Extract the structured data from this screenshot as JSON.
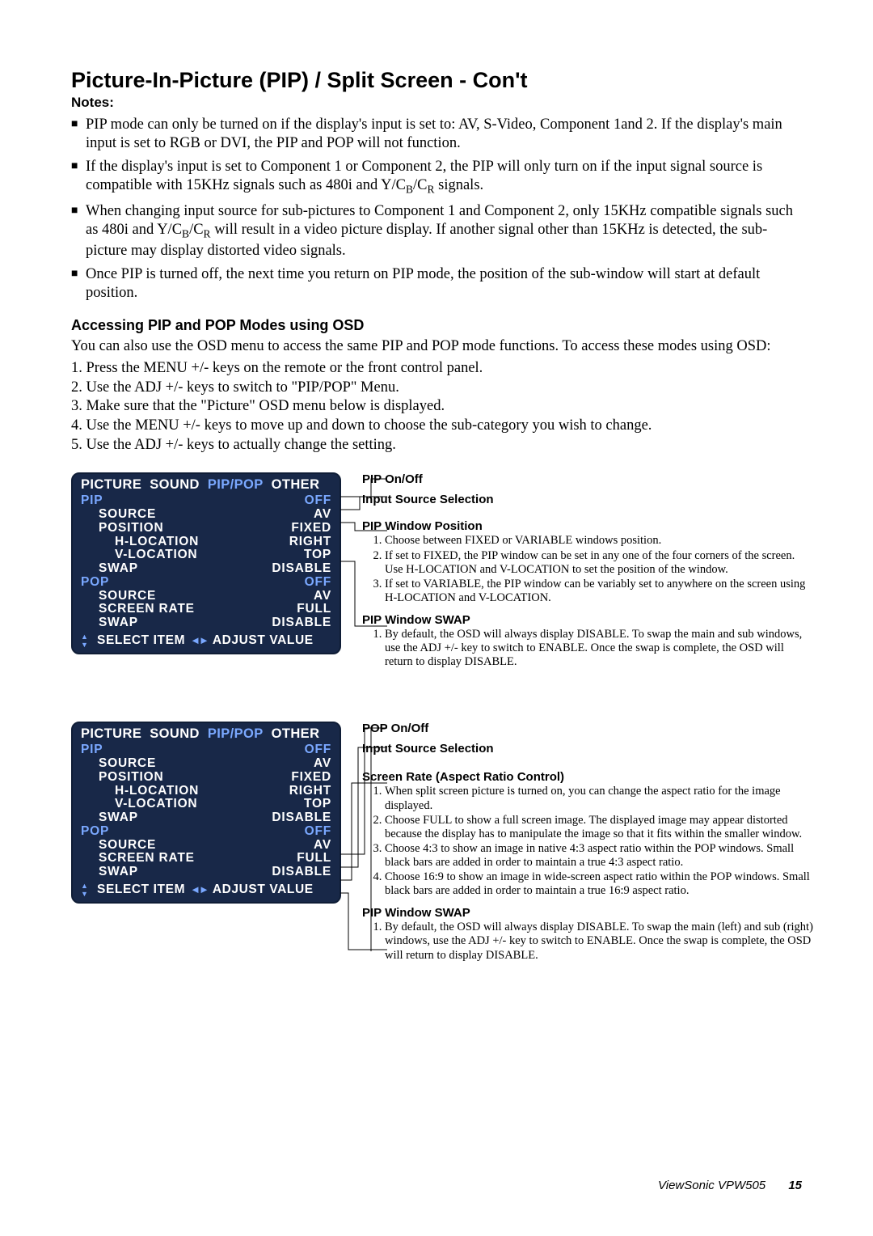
{
  "title": "Picture-In-Picture (PIP) / Split Screen - Con't",
  "notes_label": "Notes:",
  "notes": [
    "PIP mode can only be turned on if the display's input is set to: AV, S-Video, Component 1and 2.  If the display's main input is set to RGB or DVI, the PIP and POP will not function.",
    "If the display's input is set to Component 1 or Component 2, the PIP will only turn on if the input signal source is compatible with 15KHz signals such as 480i and Y/C_B/C_R signals.",
    "When changing input source for sub-pictures to Component 1 and Component 2, only 15KHz compatible signals such as 480i and Y/C_B/C_R will result in a video picture display.  If another signal other than 15KHz is detected, the sub-picture may display distorted video signals.",
    "Once PIP is turned off, the next time you return on PIP mode, the position of the sub-window will start at default position."
  ],
  "access_heading": "Accessing PIP and POP Modes using OSD",
  "access_intro": "You can also use the OSD menu to access the same PIP and POP mode functions.  To access these modes using OSD:",
  "access_steps": [
    "Press the MENU +/- keys on the remote or the front control panel.",
    "Use the ADJ +/- keys to switch to \"PIP/POP\" Menu.",
    "Make sure that the \"Picture\" OSD menu below is displayed.",
    "Use the MENU +/- keys to move up and down to choose the sub-category you wish to change.",
    "Use the ADJ +/- keys to actually change the setting."
  ],
  "osd": {
    "tabs": [
      "PICTURE",
      "SOUND",
      "PIP/POP",
      "OTHER"
    ],
    "rows": [
      {
        "label": "PIP",
        "value": "OFF",
        "head": true
      },
      {
        "label": "SOURCE",
        "value": "AV",
        "indent": 1
      },
      {
        "label": "POSITION",
        "value": "FIXED",
        "indent": 1
      },
      {
        "label": "H-LOCATION",
        "value": "RIGHT",
        "indent": 2
      },
      {
        "label": "V-LOCATION",
        "value": "TOP",
        "indent": 2
      },
      {
        "label": "SWAP",
        "value": "DISABLE",
        "indent": 1
      },
      {
        "label": "POP",
        "value": "OFF",
        "head": true
      },
      {
        "label": "SOURCE",
        "value": "AV",
        "indent": 1
      },
      {
        "label": "SCREEN  RATE",
        "value": "FULL",
        "indent": 1
      },
      {
        "label": "SWAP",
        "value": "DISABLE",
        "indent": 1
      }
    ],
    "bar_left": "SELECT  ITEM",
    "bar_right": "ADJUST  VALUE"
  },
  "callouts1": {
    "a": "PIP On/Off",
    "b": "Input Source Selection",
    "c_title": "PIP Window Position",
    "c_items": [
      "Choose between FIXED or VARIABLE windows position.",
      "If set to FIXED, the PIP window can be set in any one of the four corners of the screen.  Use H-LOCATION and V-LOCATION to set the position of the window.",
      "If set to VARIABLE, the PIP window can be variably set to anywhere on the screen using H-LOCATION and V-LOCATION."
    ],
    "d_title": "PIP Window SWAP",
    "d_items": [
      "By default, the OSD will always display DISABLE.  To swap the main and sub windows, use the ADJ +/- key to switch to ENABLE.  Once the swap is complete, the OSD will return to display DISABLE."
    ]
  },
  "callouts2": {
    "a": "POP On/Off",
    "b": "Input Source Selection",
    "c_title": "Screen Rate (Aspect Ratio Control)",
    "c_items": [
      "When split screen picture is turned on, you can change the aspect ratio for the image displayed.",
      "Choose FULL to show a full screen image.  The displayed image may appear distorted because the display has to manipulate the image so that it fits within the smaller window.",
      "Choose 4:3 to show an image in native 4:3 aspect ratio within the POP windows.  Small black bars are added in order to maintain a true 4:3 aspect ratio.",
      "Choose 16:9 to show an image in wide-screen aspect ratio within the POP windows.  Small black bars are added in order to maintain a true 16:9 aspect ratio."
    ],
    "d_title": "PIP Window SWAP",
    "d_items": [
      "By default, the OSD will always display DISABLE.  To swap the main (left) and sub (right) windows, use the ADJ +/- key to switch to ENABLE.  Once the swap is complete, the OSD will return to display DISABLE."
    ]
  },
  "footer_product": "ViewSonic  VPW505",
  "footer_page": "15"
}
